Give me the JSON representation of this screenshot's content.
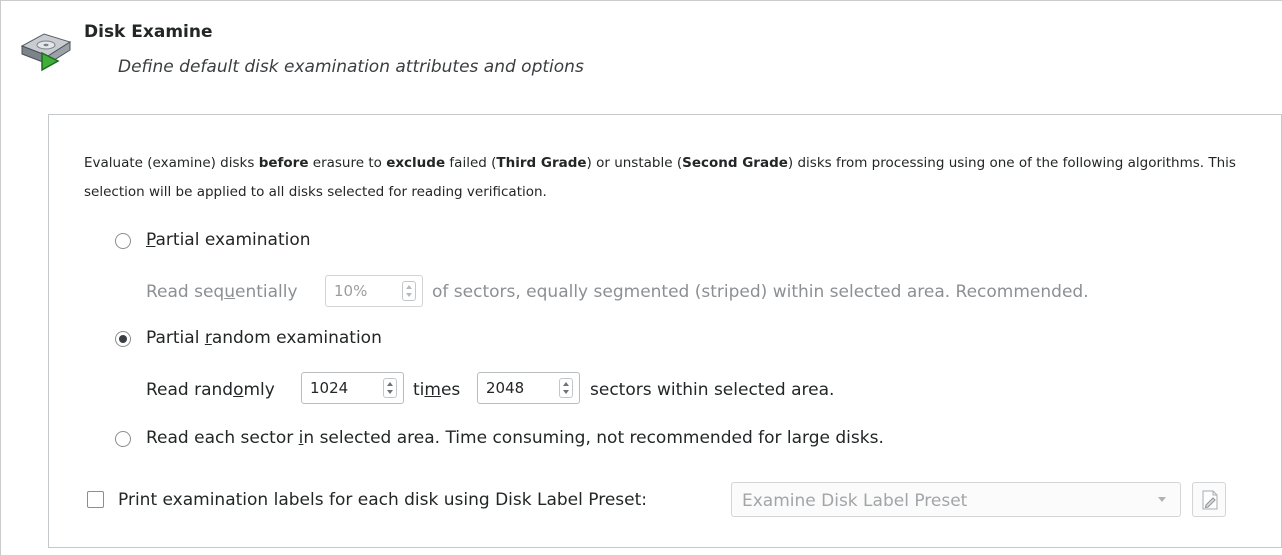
{
  "header": {
    "title": "Disk Examine",
    "subtitle": "Define default disk examination attributes and options",
    "icon": "disk-play-icon"
  },
  "description": {
    "part1": "Evaluate (examine) disks ",
    "bold1": "before",
    "part2": " erasure to ",
    "bold2": "exclude",
    "part3": " failed (",
    "bold3": "Third Grade",
    "part4": ") or unstable (",
    "bold4": "Second Grade",
    "part5": ") disks from processing using one of the following algorithms. This selection will be applied  to all disks selected for reading verification."
  },
  "options": {
    "partial": {
      "label_prefix": "",
      "label_mnemonic": "P",
      "label_rest": "artial examination",
      "selected": false,
      "detail_prefix": "Read seq",
      "detail_mnemonic": "u",
      "detail_mid": "entially",
      "percent_value": "10%",
      "detail_suffix": "of sectors, equally segmented (striped) within selected area. Recommended."
    },
    "random": {
      "label_prefix": "Partial ",
      "label_mnemonic": "r",
      "label_rest": "andom examination",
      "selected": true,
      "detail_prefix": "Read rand",
      "detail_mnemonic": "o",
      "detail_mid": "mly",
      "count_value": "1024",
      "times_prefix": "ti",
      "times_mnemonic": "m",
      "times_rest": "es",
      "sectors_value": "2048",
      "detail_suffix": "sectors within selected area."
    },
    "full": {
      "label_prefix": "Read each sector ",
      "label_mnemonic": "i",
      "label_rest": "n selected area. Time consuming, not recommended for large disks.",
      "selected": false
    }
  },
  "print_labels": {
    "label": "Print examination labels for each disk using Disk Label Preset:",
    "checked": false,
    "preset_value": "Examine Disk Label Preset",
    "edit_icon": "edit-icon"
  }
}
